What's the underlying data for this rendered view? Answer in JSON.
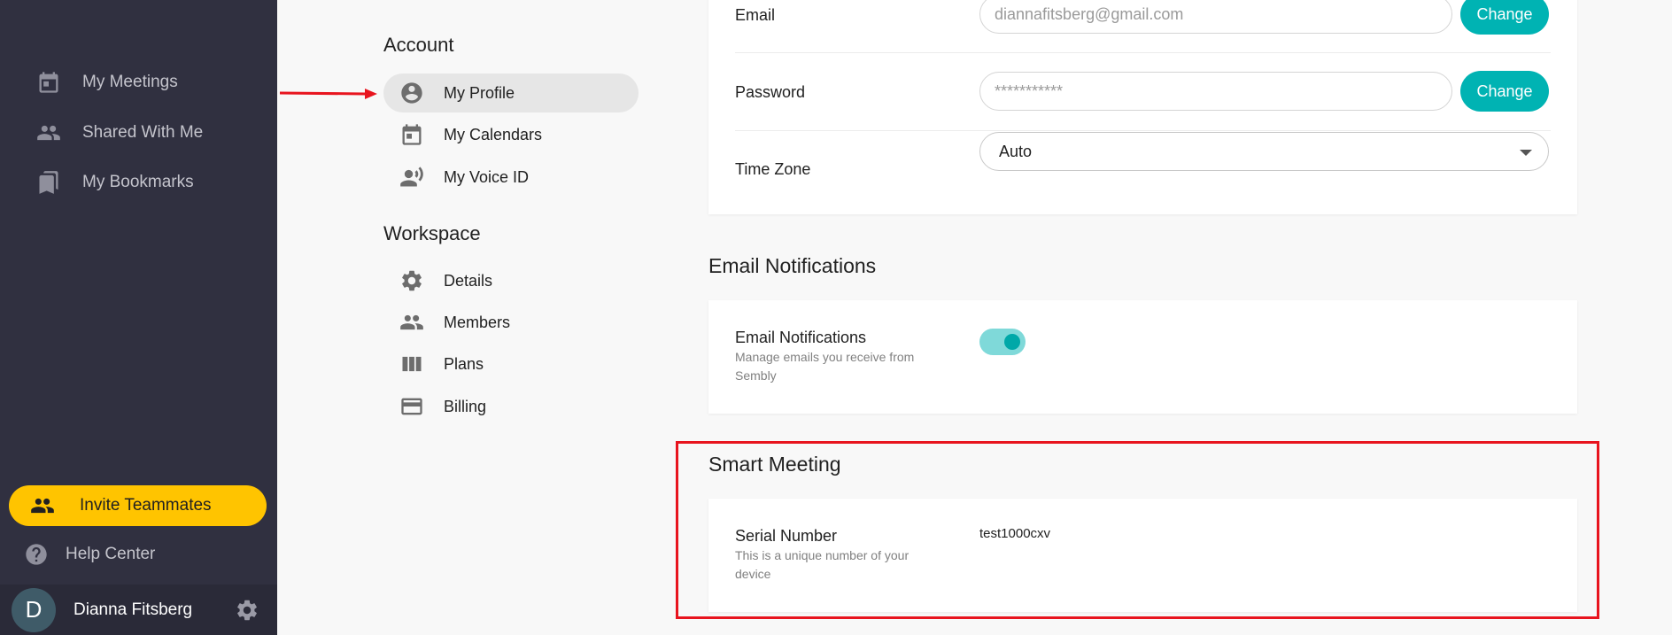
{
  "sidebar": {
    "items": [
      {
        "label": "My Meetings",
        "icon": "calendar-icon"
      },
      {
        "label": "Shared With Me",
        "icon": "people-icon"
      },
      {
        "label": "My Bookmarks",
        "icon": "bookmarks-icon"
      }
    ],
    "invite_label": "Invite Teammates",
    "help_label": "Help Center",
    "user": {
      "initial": "D",
      "name": "Dianna Fitsberg"
    }
  },
  "settings_nav": {
    "account_heading": "Account",
    "account_items": [
      {
        "label": "My Profile",
        "icon": "account-circle-icon",
        "active": true
      },
      {
        "label": "My Calendars",
        "icon": "calendar-icon"
      },
      {
        "label": "My Voice ID",
        "icon": "voice-id-icon"
      }
    ],
    "workspace_heading": "Workspace",
    "workspace_items": [
      {
        "label": "Details",
        "icon": "gear-icon"
      },
      {
        "label": "Members",
        "icon": "people-icon"
      },
      {
        "label": "Plans",
        "icon": "columns-icon"
      },
      {
        "label": "Billing",
        "icon": "credit-card-icon"
      }
    ]
  },
  "profile": {
    "email_label": "Email",
    "email_value": "diannafitsberg@gmail.com",
    "password_label": "Password",
    "password_value": "***********",
    "change_label": "Change",
    "timezone_label": "Time Zone",
    "timezone_value": "Auto"
  },
  "email_notifications": {
    "section_title": "Email Notifications",
    "label": "Email Notifications",
    "description": "Manage emails you receive from Sembly",
    "enabled": true
  },
  "smart_meeting": {
    "section_title": "Smart Meeting",
    "serial_label": "Serial Number",
    "serial_description": "This is a unique number of your device",
    "serial_value": "test1000cxv"
  },
  "colors": {
    "accent": "#00b3b3",
    "invite_yellow": "#ffc400",
    "sidebar_bg": "#303040",
    "annotation_red": "#e8141e"
  }
}
